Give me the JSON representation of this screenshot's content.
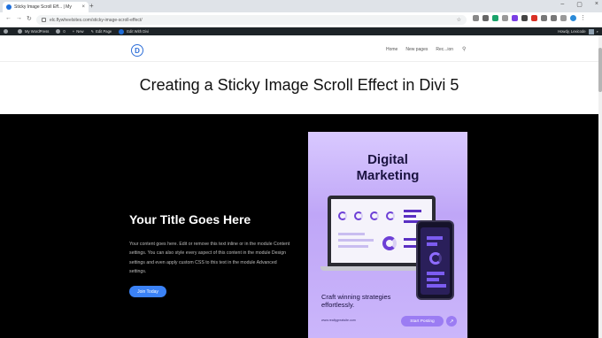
{
  "browser": {
    "tab_title": "Sticky Image Scroll Eff... | My",
    "tab_close": "×",
    "new_tab": "+",
    "url": "elc.flywheelsites.com/sticky-image-scroll-effect/",
    "window_controls": [
      "–",
      "▢",
      "×"
    ]
  },
  "adminbar": {
    "site": "My WordPress",
    "comments": "0",
    "new": "New",
    "edit_page": "Edit Page",
    "edit_with": "Edit With Divi",
    "greeting": "Howdy, Lexicode"
  },
  "header": {
    "logo": "D",
    "nav": [
      "Home",
      "New pages",
      "Rec...ion"
    ]
  },
  "page": {
    "title": "Creating a Sticky Image Scroll Effect in Divi 5"
  },
  "hero": {
    "title": "Your Title Goes Here",
    "body": "Your content goes here. Edit or remove this text inline or in the module Content settings. You can also style every aspect of this content in the module Design settings and even apply custom CSS to this text in the module Advanced settings.",
    "button": "Join Today"
  },
  "card": {
    "title_line1": "Digital",
    "title_line2": "Marketing",
    "tagline": "Craft winning strategies effortlessly.",
    "url": "www.reallygreatsite.com",
    "button": "Start Posting",
    "arrow": "↗"
  },
  "colors": {
    "accent": "#3b82f6",
    "card_purple": "#bfa6f7",
    "adminbar": "#1d2327"
  }
}
